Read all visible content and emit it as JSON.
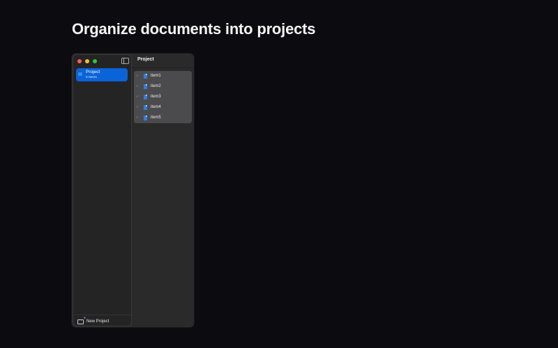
{
  "headline": "Organize documents into projects",
  "sidebar": {
    "project": {
      "name": "Project",
      "count_label": "5 Items"
    },
    "new_project_label": "New Project"
  },
  "detail": {
    "title": "Project",
    "items": [
      {
        "label": "item1"
      },
      {
        "label": "item2"
      },
      {
        "label": "item3"
      },
      {
        "label": "item4"
      },
      {
        "label": "item5"
      }
    ]
  },
  "colors": {
    "background": "#0c0c10",
    "accent": "#0a63d7",
    "file_icon": "#2f7de1",
    "close": "#ff5f57",
    "minimize": "#febc2e",
    "zoom": "#28c840"
  },
  "icons": {
    "sidebar_toggle": "sidebar-toggle-icon",
    "project": "folder-icon",
    "new_project": "new-folder-icon",
    "row_disclosure": "disclosure-icon",
    "file": "document-icon"
  }
}
